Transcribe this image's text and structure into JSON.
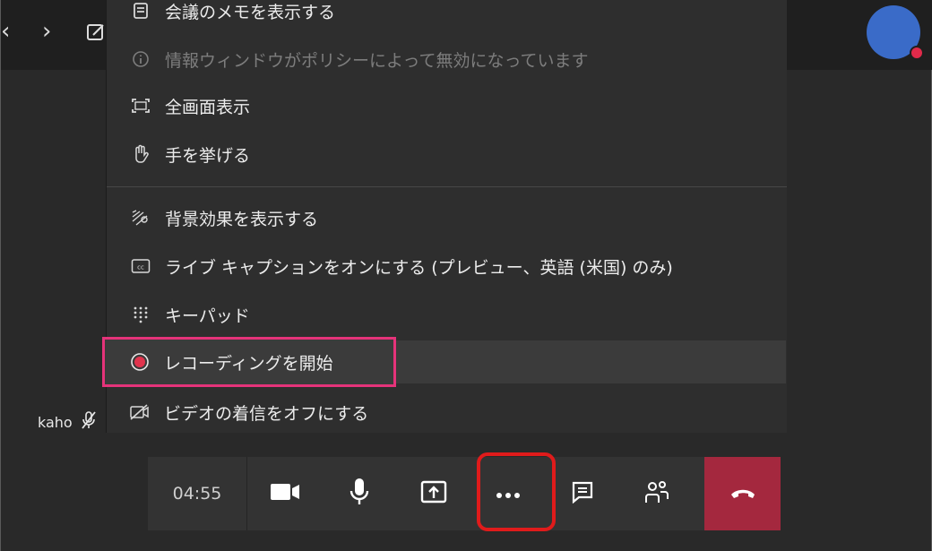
{
  "topbar": {
    "back_icon": "chevron-left-icon",
    "forward_icon": "chevron-right-icon",
    "compose_icon": "compose-icon"
  },
  "menu": {
    "items": [
      {
        "icon": "notes-icon",
        "label": "会議のメモを表示する",
        "disabled": false
      },
      {
        "icon": "info-icon",
        "label": "情報ウィンドウがポリシーによって無効になっています",
        "disabled": true
      },
      {
        "icon": "fullscreen-icon",
        "label": "全画面表示",
        "disabled": false
      },
      {
        "icon": "raise-hand-icon",
        "label": "手を挙げる",
        "disabled": false
      },
      {
        "icon": "background-effects-icon",
        "label": "背景効果を表示する",
        "disabled": false
      },
      {
        "icon": "closed-captions-icon",
        "label": "ライブ キャプションをオンにする (プレビュー、英語 (米国) のみ)",
        "disabled": false
      },
      {
        "icon": "keypad-icon",
        "label": "キーパッド",
        "disabled": false
      },
      {
        "icon": "record-icon",
        "label": "レコーディングを開始",
        "disabled": false
      },
      {
        "icon": "video-off-icon",
        "label": "ビデオの着信をオフにする",
        "disabled": false
      }
    ]
  },
  "participant": {
    "name": "kaho",
    "mic_icon": "mic-muted-icon"
  },
  "callbar": {
    "timer": "04:55",
    "buttons": [
      {
        "name": "camera-button",
        "icon": "video-camera-icon"
      },
      {
        "name": "mic-button",
        "icon": "microphone-icon"
      },
      {
        "name": "share-button",
        "icon": "share-screen-icon"
      },
      {
        "name": "more-actions-button",
        "icon": "ellipsis-icon"
      },
      {
        "name": "chat-button",
        "icon": "chat-icon"
      },
      {
        "name": "participants-button",
        "icon": "people-icon"
      },
      {
        "name": "hangup-button",
        "icon": "phone-hangup-icon"
      }
    ]
  },
  "colors": {
    "background": "#292929",
    "menu_bg": "#2e2e2e",
    "highlight_pink": "#e5337a",
    "highlight_red": "#e01b1b",
    "hangup": "#a4283e",
    "record_dot": "#e0344d",
    "avatar": "#3a6bc8"
  }
}
